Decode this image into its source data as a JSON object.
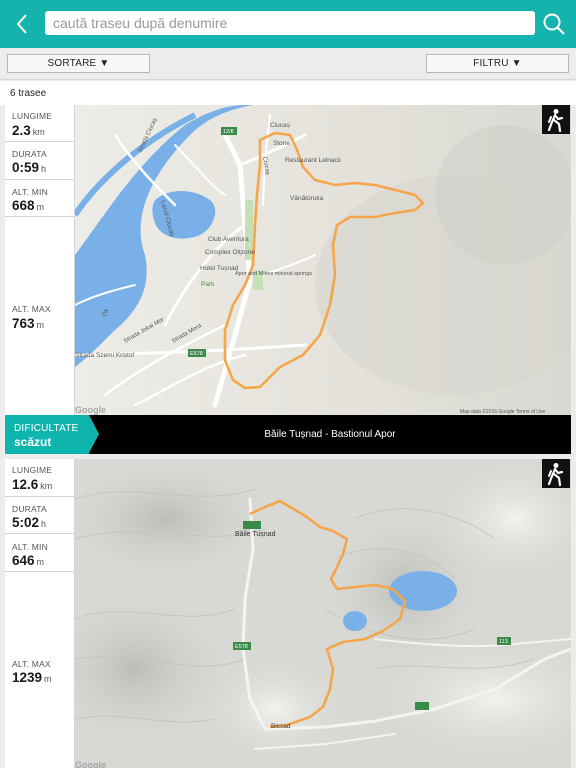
{
  "header": {
    "search_placeholder": "caută traseu după denumire",
    "back_icon": "chevron-left-icon",
    "search_icon": "search-icon"
  },
  "toolbar": {
    "sort_label": "SORTARE ▼",
    "filter_label": "FILTRU ▼"
  },
  "list": {
    "count_label": "6 trasee"
  },
  "routes": [
    {
      "stats": {
        "length_label": "LUNGIME",
        "length_value": "2.3",
        "length_unit": "km",
        "duration_label": "DURATA",
        "duration_value": "0:59",
        "duration_unit": "h",
        "alt_min_label": "ALT. MIN",
        "alt_min_value": "668",
        "alt_min_unit": "m",
        "alt_max_label": "ALT. MAX",
        "alt_max_value": "763",
        "alt_max_unit": "m"
      },
      "difficulty_label": "DIFICULTATE",
      "difficulty_value": "scăzut",
      "name": "Băile Tușnad - Bastionul Apor",
      "activity_icon": "hiking-icon",
      "map": {
        "labels": {
          "ciucas": "Ciucaș",
          "stone": "Stone",
          "restaurant": "Restaurant Lelnacii",
          "vanatoruka": "Vânătoruka",
          "lacul": "Lacul Ciucaș",
          "club": "Club Aventura",
          "complex": "Complex Olțzone",
          "hotel": "Hotel Tușnad",
          "park": "Park",
          "apor": "Apor and Mikes mineral springs",
          "str_cuciuc": "Strada Ciucaș",
          "str_jokai": "Strada Jokai Mor",
          "str_mora": "Strada Mora",
          "olt": "Olt",
          "street_left": "Strada Szemi Kristof",
          "road_top": "12/8",
          "road_bottom": "E578",
          "google": "Google",
          "map_data": "Map data ©2016 Google   Terms of Use"
        }
      }
    },
    {
      "stats": {
        "length_label": "LUNGIME",
        "length_value": "12.6",
        "length_unit": "km",
        "duration_label": "DURATA",
        "duration_value": "5:02",
        "duration_unit": "h",
        "alt_min_label": "ALT. MIN",
        "alt_min_value": "646",
        "alt_min_unit": "m",
        "alt_max_label": "ALT. MAX",
        "alt_max_value": "1239",
        "alt_max_unit": "m"
      },
      "activity_icon": "hiking-icon",
      "map": {
        "labels": {
          "baile": "Băile Tușnad",
          "bicsad": "Bicsad",
          "road_e578": "E578",
          "road_113": "113",
          "google": "Google"
        }
      }
    }
  ]
}
